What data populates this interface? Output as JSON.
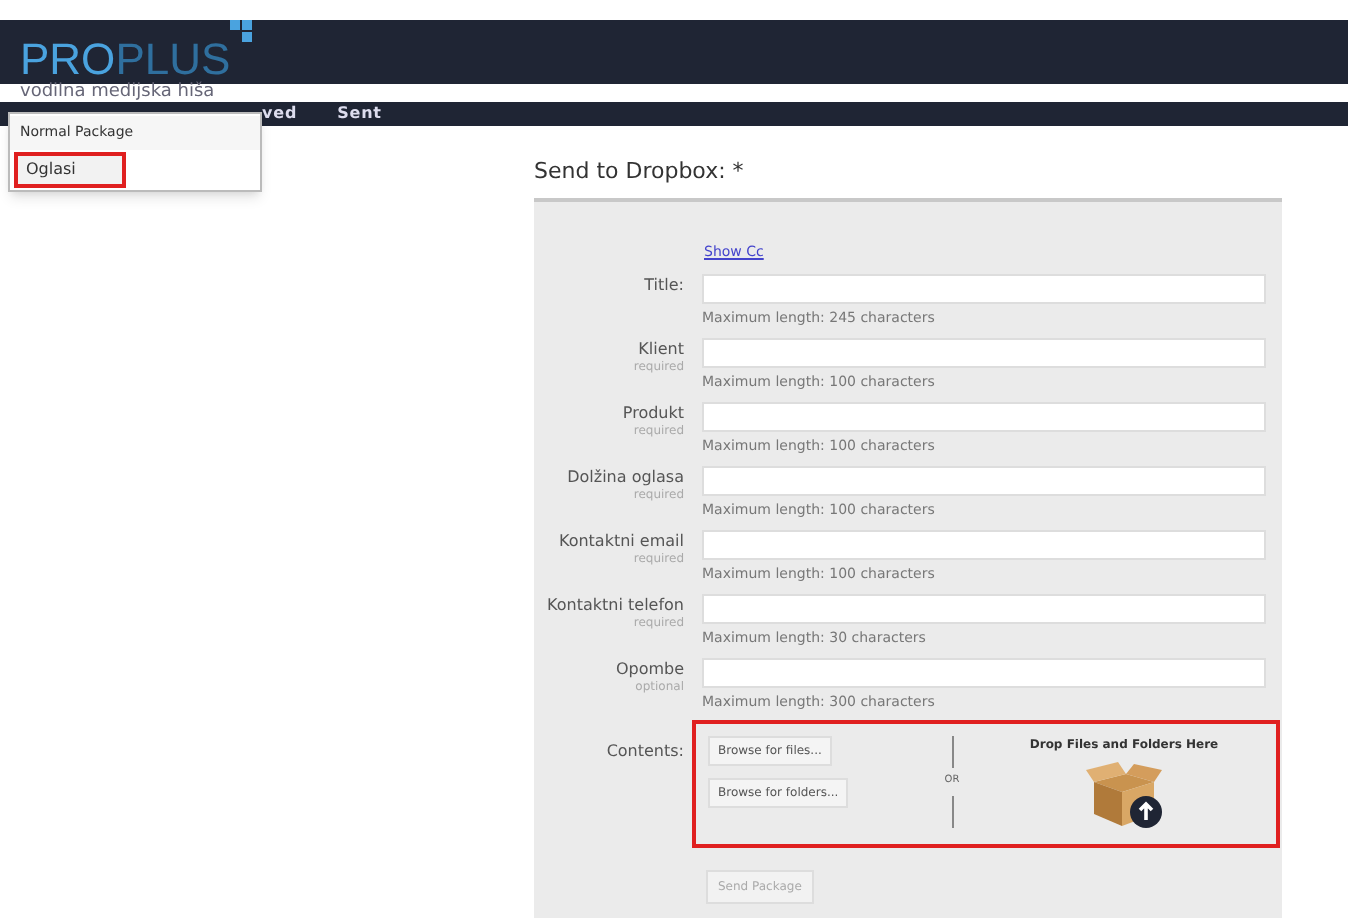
{
  "header": {
    "logo_bold": "PRO",
    "logo_light": "PLUS",
    "tagline": "vodilna medijska hiša"
  },
  "nav": {
    "items": [
      "ved",
      "Sent"
    ]
  },
  "dropdown": {
    "items": [
      {
        "label": "Normal Package",
        "highlighted": false
      },
      {
        "label": "Oglasi",
        "highlighted": true
      }
    ]
  },
  "form": {
    "title": "Send to Dropbox: *",
    "show_cc": "Show Cc",
    "fields": [
      {
        "label": "Title:",
        "hint": "Maximum length: 245 characters"
      },
      {
        "label": "Klient",
        "note": "required",
        "hint": "Maximum length: 100 characters"
      },
      {
        "label": "Produkt",
        "note": "required",
        "hint": "Maximum length: 100 characters"
      },
      {
        "label": "Dolžina oglasa",
        "note": "required",
        "hint": "Maximum length: 100 characters"
      },
      {
        "label": "Kontaktni email",
        "note": "required",
        "hint": "Maximum length: 100 characters"
      },
      {
        "label": "Kontaktni telefon",
        "note": "required",
        "hint": "Maximum length: 30 characters"
      },
      {
        "label": "Opombe",
        "note": "optional",
        "hint": "Maximum length: 300 characters"
      }
    ],
    "contents": {
      "label": "Contents:",
      "highlighted": true,
      "buttons": [
        "Browse for files...",
        "Browse for folders..."
      ],
      "or": "OR",
      "drop_text": "Drop Files and Folders Here"
    },
    "submit": {
      "label": "Send Package",
      "disabled": true
    }
  }
}
